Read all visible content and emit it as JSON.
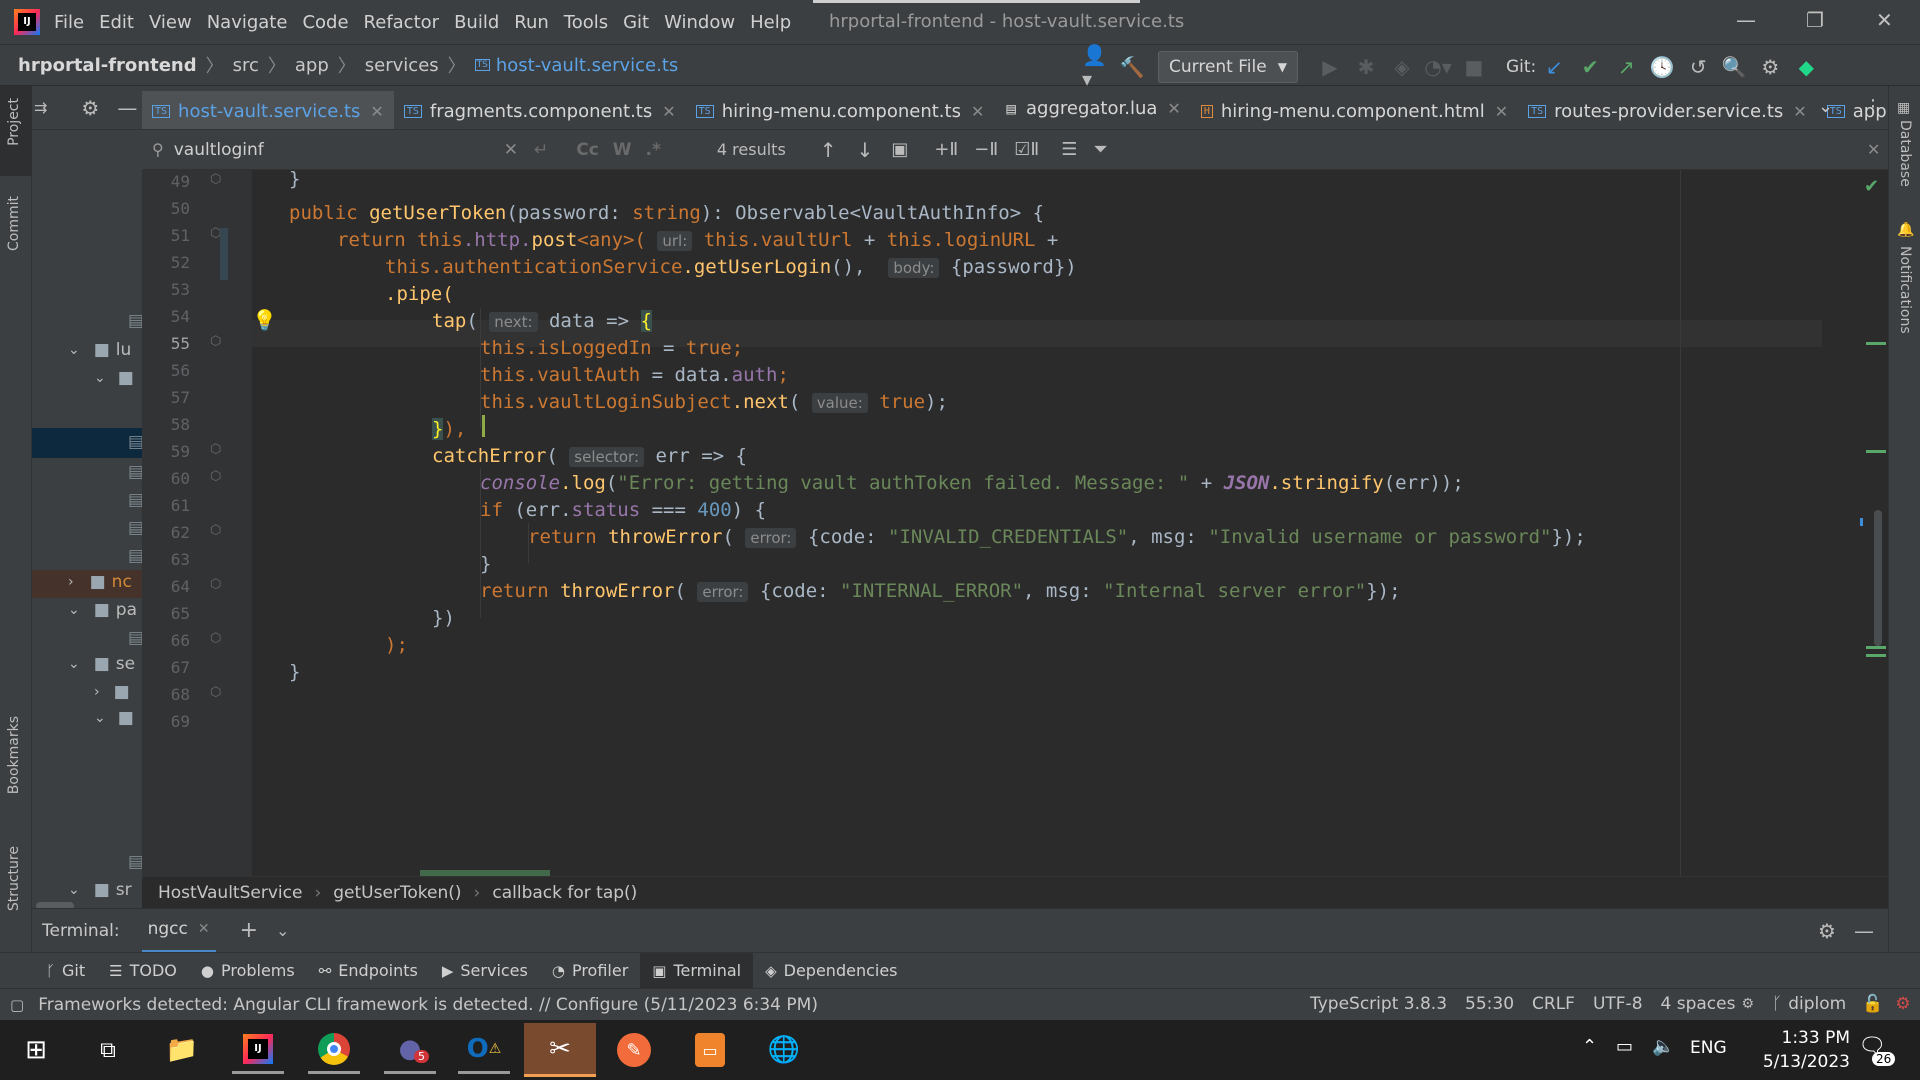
{
  "window": {
    "title": "hrportal-frontend - host-vault.service.ts",
    "menu": [
      "File",
      "Edit",
      "View",
      "Navigate",
      "Code",
      "Refactor",
      "Build",
      "Run",
      "Tools",
      "Git",
      "Window",
      "Help"
    ],
    "controls": {
      "minimize": "—",
      "maximize": "❐",
      "close": "✕"
    }
  },
  "navbar": {
    "breadcrumbs": [
      "hrportal-frontend",
      "src",
      "app",
      "services",
      "host-vault.service.ts"
    ],
    "run_config": "Current File",
    "git_label": "Git:"
  },
  "left_strip": {
    "project": "Project",
    "commit": "Commit",
    "bookmarks": "Bookmarks",
    "structure": "Structure"
  },
  "right_strip": {
    "database": "Database",
    "notifications": "Notifications"
  },
  "project_tree": [
    {
      "label": "lu",
      "icon": "folder-icon",
      "expanded": true
    },
    {
      "label": "nc",
      "icon": "folder-icon",
      "expanded": false
    },
    {
      "label": "pa",
      "icon": "folder-icon",
      "expanded": true
    },
    {
      "label": "se",
      "icon": "folder-icon",
      "expanded": true
    },
    {
      "label": "sr",
      "icon": "folder-icon",
      "expanded": true
    }
  ],
  "tabs": [
    {
      "label": "host-vault.service.ts",
      "type": "TS",
      "active": true
    },
    {
      "label": "fragments.component.ts",
      "type": "TS",
      "active": false
    },
    {
      "label": "hiring-menu.component.ts",
      "type": "TS",
      "active": false
    },
    {
      "label": "aggregator.lua",
      "type": "LUA",
      "active": false
    },
    {
      "label": "hiring-menu.component.html",
      "type": "H",
      "active": false
    },
    {
      "label": "routes-provider.service.ts",
      "type": "TS",
      "active": false
    },
    {
      "label": "app.co",
      "type": "TS",
      "active": false
    }
  ],
  "search": {
    "query": "vaultloginf",
    "results": "4 results",
    "opt_case": "Cc",
    "opt_word": "W",
    "opt_regex": ".*"
  },
  "editor": {
    "line_numbers": [
      "49",
      "50",
      "51",
      "52",
      "53",
      "54",
      "55",
      "56",
      "57",
      "58",
      "59",
      "60",
      "61",
      "62",
      "63",
      "64",
      "65",
      "66",
      "67",
      "68",
      "69"
    ],
    "current_line": "55",
    "hints": {
      "url": "url:",
      "body": "body:",
      "next": "next:",
      "value": "value:",
      "selector": "selector:",
      "error": "error:"
    },
    "text": {
      "l49": "}",
      "l51_kw": "public",
      "l51_fn": "getUserToken",
      "l51_rest": "(password: ",
      "l51_type": "string",
      "l51_tail": "): Observable<VaultAuthInfo> {",
      "l52_kw": "return",
      "l52_this": "this",
      "l52_http": ".http.",
      "l52_post": "post",
      "l52_any": "<any>(",
      "l52_vault": "this.vaultUrl",
      "l52_plus": " + ",
      "l52_login": "this.loginURL",
      "l52_end": " +",
      "l53_auth": "this.authenticationService",
      "l53_get": ".getUserLogin",
      "l53_paren": "(),",
      "l53_body": "{password})",
      "l54": ".pipe(",
      "l55_tap": "tap",
      "l55_paren": "(",
      "l55_data": "data => ",
      "l55_brace": "{",
      "l56_this": "this.isLoggedIn",
      "l56_eq": " = ",
      "l56_val": "true",
      "l56_end": ";",
      "l57_this": "this.vaultAuth",
      "l57_eq": " = data.",
      "l57_auth": "auth",
      "l57_end": ";",
      "l58_this": "this.vaultLoginSubject",
      "l58_next": ".next",
      "l58_paren": "(",
      "l58_val": "true",
      "l58_end": ");",
      "l59_brace": "}",
      "l59_end": "),",
      "l60_fn": "catchError",
      "l60_paren": "(",
      "l60_err": "err => {",
      "l61_console": "console",
      "l61_log": ".log",
      "l61_str": "\"Error: getting vault authToken failed. Message: \"",
      "l61_plus": " + ",
      "l61_json": "JSON",
      "l61_stringify": ".stringify",
      "l61_end": "(err));",
      "l62_if": "if",
      "l62_cond": " (err.",
      "l62_status": "status",
      "l62_op": " === ",
      "l62_num": "400",
      "l62_end": ") {",
      "l63_ret": "return",
      "l63_fn": "throwError",
      "l63_code_key": "{code: ",
      "l63_code_val": "\"INVALID_CREDENTIALS\"",
      "l63_msg_key": ", msg: ",
      "l63_msg_val": "\"Invalid username or password\"",
      "l63_end": "});",
      "l64": "}",
      "l65_ret": "return",
      "l65_fn": "throwError",
      "l65_code_key": "{code: ",
      "l65_code_val": "\"INTERNAL_ERROR\"",
      "l65_msg_key": ", msg: ",
      "l65_msg_val": "\"Internal server error\"",
      "l65_end": "});",
      "l66": "})",
      "l67": ");",
      "l68": "}"
    }
  },
  "code_breadcrumbs": [
    "HostVaultService",
    "getUserToken()",
    "callback for tap()"
  ],
  "terminal": {
    "label": "Terminal:",
    "tab": "ngcc"
  },
  "tool_windows": [
    {
      "label": "Git",
      "icon": "branch-icon"
    },
    {
      "label": "TODO",
      "icon": "list-icon"
    },
    {
      "label": "Problems",
      "icon": "warning-icon"
    },
    {
      "label": "Endpoints",
      "icon": "endpoints-icon"
    },
    {
      "label": "Services",
      "icon": "services-icon"
    },
    {
      "label": "Profiler",
      "icon": "profiler-icon"
    },
    {
      "label": "Terminal",
      "icon": "terminal-icon",
      "active": true
    },
    {
      "label": "Dependencies",
      "icon": "dependencies-icon"
    }
  ],
  "status_bar": {
    "message": "Frameworks detected: Angular CLI framework is detected. // Configure (5/11/2023 6:34 PM)",
    "language": "TypeScript 3.8.3",
    "position": "55:30",
    "line_sep": "CRLF",
    "encoding": "UTF-8",
    "indent": "4 spaces",
    "branch": "diplom"
  },
  "taskbar": {
    "time": "1:33 PM",
    "date": "5/13/2023",
    "lang": "ENG",
    "notif_count": "26",
    "teams_badge": "5"
  },
  "colors": {
    "accent": "#4a88c7",
    "keyword": "#cc7832",
    "function": "#ffc66d",
    "field": "#9876aa",
    "string": "#6a8759",
    "number": "#6897bb"
  }
}
